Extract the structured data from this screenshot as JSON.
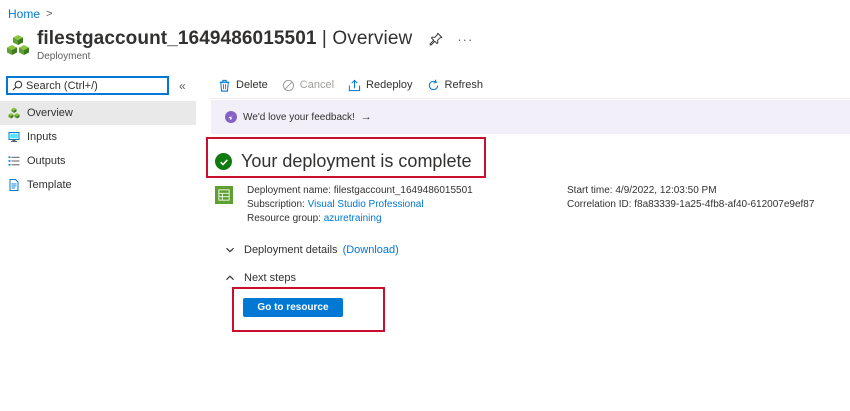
{
  "breadcrumb": {
    "home": "Home",
    "separator": ">"
  },
  "header": {
    "resource_name": "filestgaccount_1649486015501",
    "separator": " | ",
    "blade": "Overview",
    "subtitle": "Deployment",
    "more": "···"
  },
  "sidebar": {
    "search_placeholder": "Search (Ctrl+/)",
    "collapse": "«",
    "items": [
      {
        "label": "Overview",
        "icon": "overview-cubes-icon",
        "active": true
      },
      {
        "label": "Inputs",
        "icon": "inputs-icon",
        "active": false
      },
      {
        "label": "Outputs",
        "icon": "outputs-list-icon",
        "active": false
      },
      {
        "label": "Template",
        "icon": "template-doc-icon",
        "active": false
      }
    ]
  },
  "toolbar": {
    "delete": "Delete",
    "cancel": "Cancel",
    "redeploy": "Redeploy",
    "refresh": "Refresh"
  },
  "feedback": {
    "text": "We'd love your feedback!",
    "arrow": "→"
  },
  "status": {
    "title": "Your deployment is complete"
  },
  "details": {
    "deployment_name_label": "Deployment name:",
    "deployment_name": "filestgaccount_1649486015501",
    "subscription_label": "Subscription:",
    "subscription": "Visual Studio Professional",
    "resource_group_label": "Resource group:",
    "resource_group": "azuretraining",
    "start_time_label": "Start time:",
    "start_time": "4/9/2022, 12:03:50 PM",
    "correlation_label": "Correlation ID:",
    "correlation_id": "f8a83339-1a25-4fb8-af40-612007e9ef87"
  },
  "sections": {
    "deployment_details": "Deployment details",
    "download": "(Download)",
    "next_steps": "Next steps"
  },
  "actions": {
    "go_to_resource": "Go to resource"
  },
  "colors": {
    "accent": "#0078d4",
    "success": "#107c10",
    "highlight_box": "#c8102e",
    "feedback_bg": "#f3eff8",
    "active_nav": "#e9e9e9"
  }
}
